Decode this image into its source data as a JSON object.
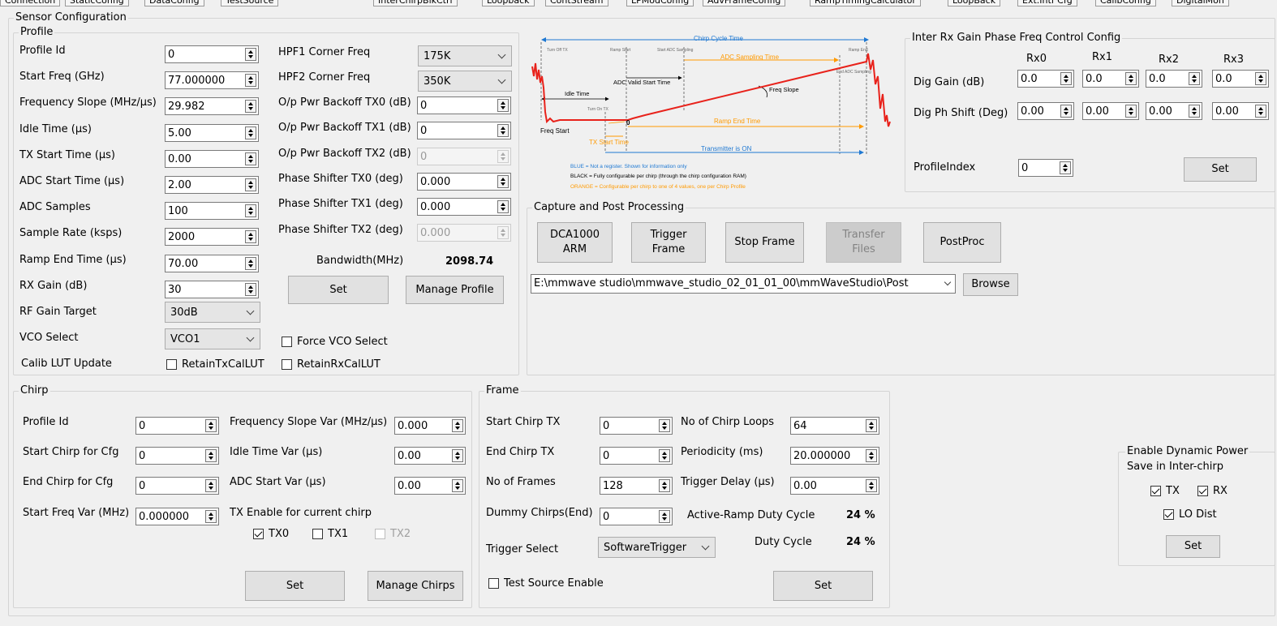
{
  "tabs": [
    "Connection",
    "StaticConfig",
    "DataConfig",
    "TestSource",
    "InterChirpBlkCtrl",
    "Loopback",
    "ContStream",
    "LPModConfig",
    "AdvFrameConfig",
    "RampTimingCalculator",
    "LoopBack",
    "Ext.Intf Cfg",
    "CalibConfig",
    "DigitalMon"
  ],
  "sensor_config": {
    "title": "Sensor Configuration",
    "profile": {
      "title": "Profile",
      "left_fields": [
        {
          "label": "Profile Id",
          "value": "0"
        },
        {
          "label": "Start Freq (GHz)",
          "value": "77.000000"
        },
        {
          "label": "Frequency Slope (MHz/µs)",
          "value": "29.982"
        },
        {
          "label": "Idle Time (µs)",
          "value": "5.00"
        },
        {
          "label": "TX Start Time (µs)",
          "value": "0.00"
        },
        {
          "label": "ADC Start Time (µs)",
          "value": "2.00"
        },
        {
          "label": "ADC Samples",
          "value": "100"
        },
        {
          "label": "Sample Rate (ksps)",
          "value": "2000"
        },
        {
          "label": "Ramp End Time (µs)",
          "value": "70.00"
        },
        {
          "label": "RX Gain (dB)",
          "value": "30"
        }
      ],
      "rf_gain_target": {
        "label": "RF Gain Target",
        "value": "30dB"
      },
      "vco_select": {
        "label": "VCO Select",
        "value": "VCO1"
      },
      "force_vco": "Force VCO Select",
      "calib_lut": {
        "label": "Calib LUT Update",
        "retain_tx": "RetainTxCalLUT",
        "retain_rx": "RetainRxCalLUT"
      },
      "hpf1": {
        "label": "HPF1 Corner Freq",
        "value": "175K"
      },
      "hpf2": {
        "label": "HPF2 Corner Freq",
        "value": "350K"
      },
      "right_fields": [
        {
          "label": "O/p Pwr Backoff TX0 (dB)",
          "value": "0",
          "disabled": false
        },
        {
          "label": "O/p Pwr Backoff TX1 (dB)",
          "value": "0",
          "disabled": false
        },
        {
          "label": "O/p Pwr Backoff TX2 (dB)",
          "value": "0",
          "disabled": true
        },
        {
          "label": "Phase Shifter TX0 (deg)",
          "value": "0.000",
          "disabled": false
        },
        {
          "label": "Phase Shifter TX1 (deg)",
          "value": "0.000",
          "disabled": false
        },
        {
          "label": "Phase Shifter TX2 (deg)",
          "value": "0.000",
          "disabled": true
        }
      ],
      "bandwidth_label": "Bandwidth(MHz)",
      "bandwidth_value": "2098.74",
      "set": "Set",
      "manage": "Manage Profile"
    }
  },
  "diagram": {
    "chirp_cycle": "Chirp Cycle Time",
    "turn_off_tx": "Turn Off TX",
    "ramp_start": "Ramp Start",
    "start_adc": "Start ADC Sampling",
    "ramp_end": "Ramp End",
    "adc_sampling": "ADC Sampling Time",
    "end_adc": "End ADC Sampling",
    "adc_valid": "ADC Valid Start Time",
    "freq_slope": "Freq Slope",
    "idle_time": "Idle Time",
    "turn_on_tx": "Turn On TX",
    "freq_start": "Freq Start",
    "zero": "0",
    "ramp_end_time": "Ramp End Time",
    "tx_start": "TX Start Time",
    "tx_on": "Transmitter is ON",
    "legend_blue": "BLUE = Not a register. Shown for information only",
    "legend_black": "BLACK = Fully configurable per chirp (through the chirp configuration RAM)",
    "legend_orange": "ORANGE = Configurable per chirp to one of 4 values, one per Chirp Profile",
    "colors": {
      "blue": "#1e78d2",
      "orange": "#ff9a00",
      "red": "#e8221b"
    }
  },
  "rx_gain": {
    "title": "Inter Rx Gain Phase Freq Control Config",
    "cols": [
      "Rx0",
      "Rx1",
      "Rx2",
      "Rx3"
    ],
    "dig_gain_label": "Dig Gain (dB)",
    "dig_gain": [
      "0.0",
      "0.0",
      "0.0",
      "0.0"
    ],
    "dig_ph_label": "Dig Ph Shift (Deg)",
    "dig_ph": [
      "0.00",
      "0.00",
      "0.00",
      "0.00"
    ],
    "profile_index_label": "ProfileIndex",
    "profile_index": "0",
    "set": "Set"
  },
  "capture": {
    "title": "Capture and Post Processing",
    "dca": "DCA1000\nARM",
    "trigger": "Trigger\nFrame",
    "stop": "Stop Frame",
    "transfer": "Transfer\nFiles",
    "postproc": "PostProc",
    "path": "E:\\mmwave studio\\mmwave_studio_02_01_01_00\\mmWaveStudio\\Post",
    "browse": "Browse"
  },
  "chirp": {
    "title": "Chirp",
    "left_fields": [
      {
        "label": "Profile Id",
        "value": "0"
      },
      {
        "label": "Start Chirp for Cfg",
        "value": "0"
      },
      {
        "label": "End Chirp for Cfg",
        "value": "0"
      },
      {
        "label": "Start Freq Var (MHz)",
        "value": "0.000000"
      }
    ],
    "right_fields": [
      {
        "label": "Frequency Slope Var (MHz/µs)",
        "value": "0.000"
      },
      {
        "label": "Idle Time Var (µs)",
        "value": "0.00"
      },
      {
        "label": "ADC Start Var (µs)",
        "value": "0.00"
      }
    ],
    "tx_enable_label": "TX Enable for current chirp",
    "tx0": "TX0",
    "tx1": "TX1",
    "tx2": "TX2",
    "set": "Set",
    "manage": "Manage Chirps"
  },
  "frame": {
    "title": "Frame",
    "left_fields": [
      {
        "label": "Start Chirp TX",
        "value": "0"
      },
      {
        "label": "End Chirp TX",
        "value": "0"
      },
      {
        "label": "No of Frames",
        "value": "128"
      },
      {
        "label": "Dummy Chirps(End)",
        "value": "0"
      }
    ],
    "right_fields": [
      {
        "label": "No of Chirp Loops",
        "value": "64"
      },
      {
        "label": "Periodicity (ms)",
        "value": "20.000000"
      },
      {
        "label": "Trigger Delay (µs)",
        "value": "0.00"
      }
    ],
    "active_ramp_label": "Active-Ramp Duty Cycle",
    "active_ramp_value": "24 %",
    "duty_label": "Duty Cycle",
    "duty_value": "24 %",
    "trigger_select_label": "Trigger Select",
    "trigger_select_value": "SoftwareTrigger",
    "test_source": "Test Source Enable",
    "set": "Set"
  },
  "dyn_power": {
    "title_line1": "Enable Dynamic Power",
    "title_line2": "Save in Inter-chirp",
    "tx": "TX",
    "rx": "RX",
    "lo": "LO Dist",
    "set": "Set"
  }
}
